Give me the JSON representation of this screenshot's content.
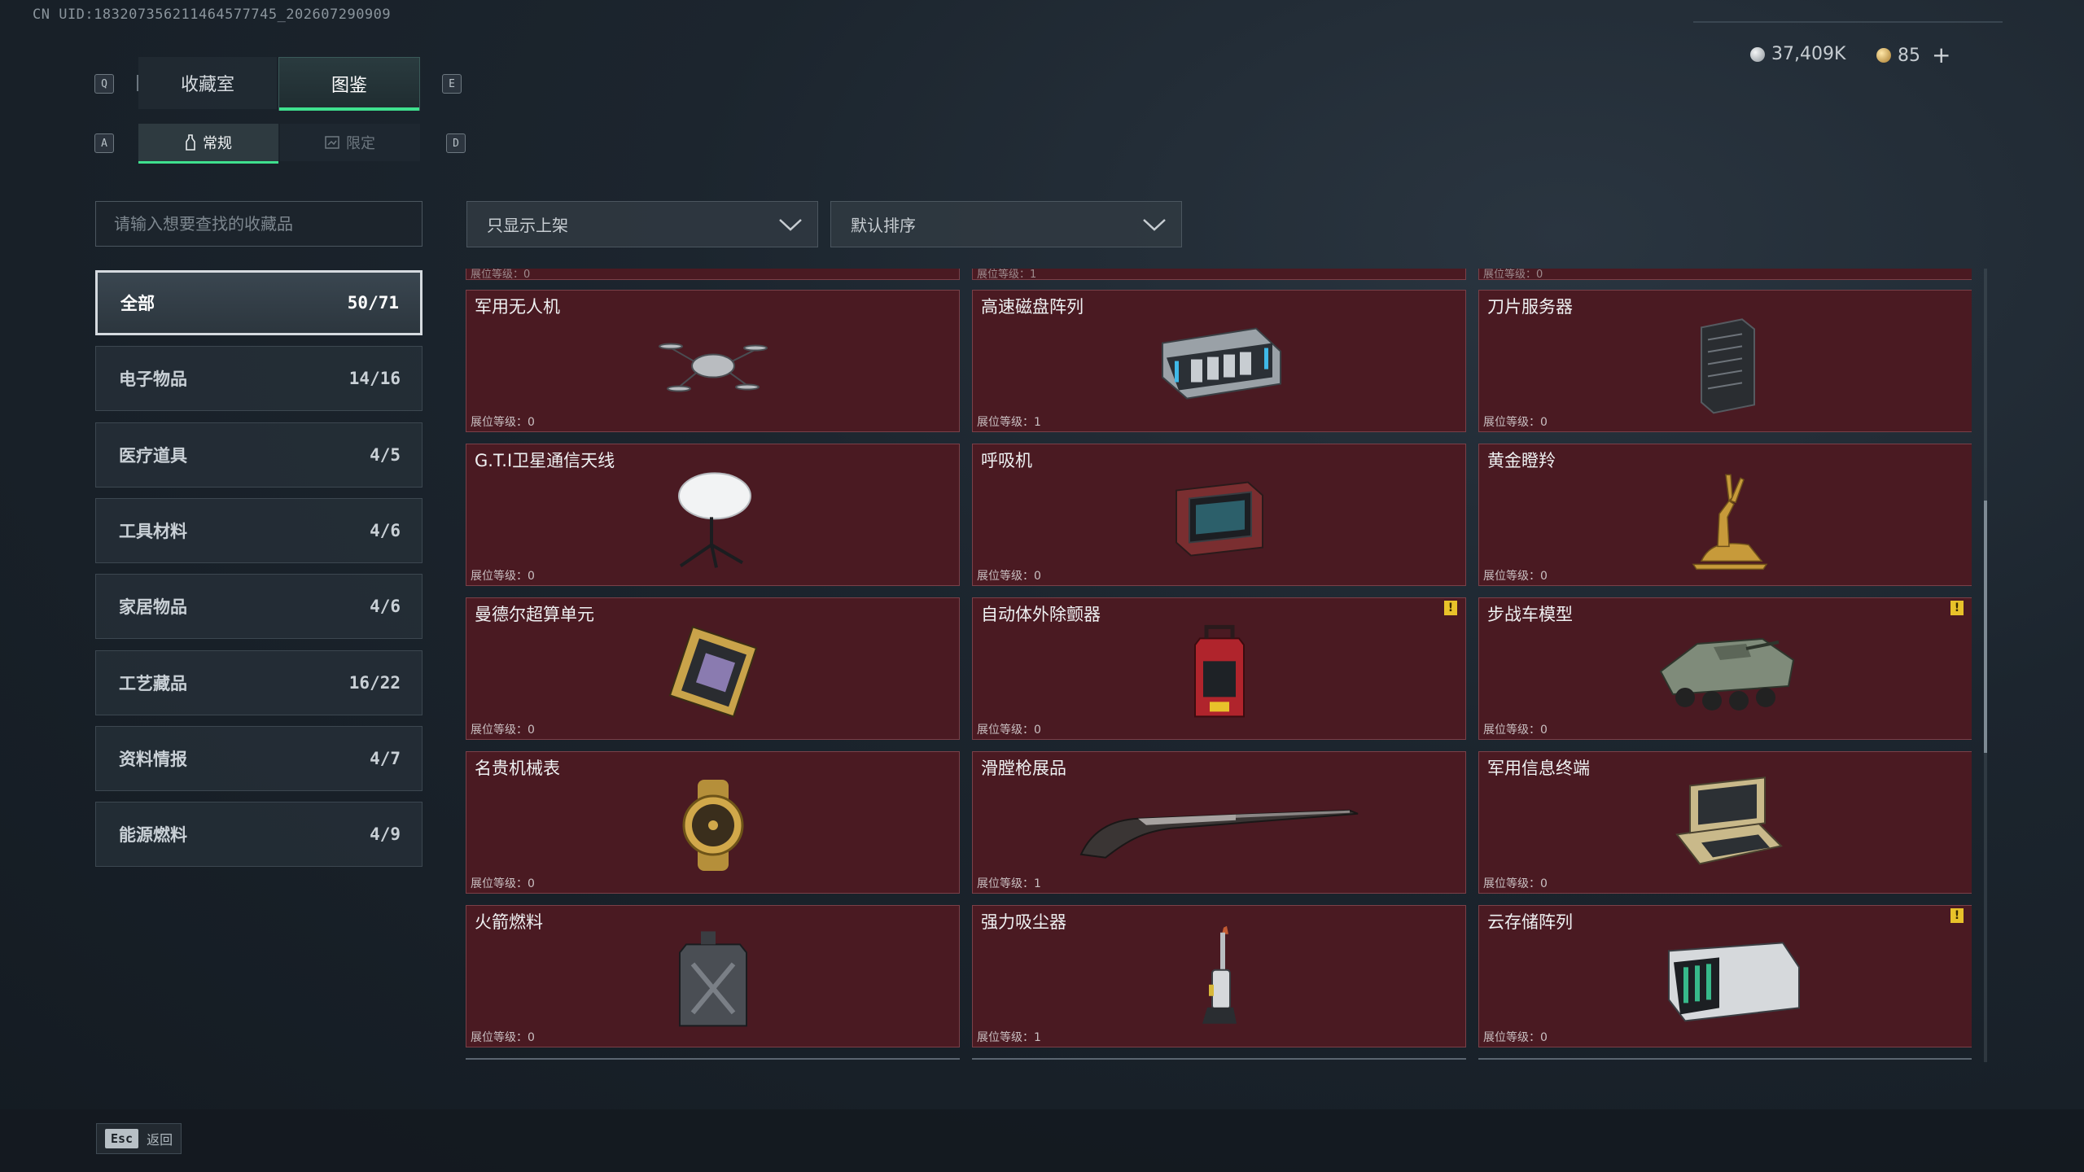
{
  "uid_text": "CN UID:183207356211464577745_202607290909",
  "currency": {
    "silver": "37,409K",
    "gold": "85",
    "add": "+"
  },
  "key_hints": {
    "q": "Q",
    "e": "E",
    "a": "A",
    "d": "D"
  },
  "tabs": [
    {
      "label": "收藏室",
      "active": false
    },
    {
      "label": "图鉴",
      "active": true
    }
  ],
  "subtabs": [
    {
      "label": "常规",
      "active": true
    },
    {
      "label": "限定",
      "active": false
    }
  ],
  "search": {
    "placeholder": "请输入想要查找的收藏品"
  },
  "filters": {
    "display": "只显示上架",
    "sort": "默认排序"
  },
  "categories": [
    {
      "label": "全部",
      "count": "50/71",
      "active": true
    },
    {
      "label": "电子物品",
      "count": "14/16"
    },
    {
      "label": "医疗道具",
      "count": "4/5"
    },
    {
      "label": "工具材料",
      "count": "4/6"
    },
    {
      "label": "家居物品",
      "count": "4/6"
    },
    {
      "label": "工艺藏品",
      "count": "16/22"
    },
    {
      "label": "资料情报",
      "count": "4/7"
    },
    {
      "label": "能源燃料",
      "count": "4/9"
    }
  ],
  "peek_row": [
    "展位等级：0",
    "展位等级：1",
    "展位等级：0"
  ],
  "items": [
    {
      "name": "军用无人机",
      "level": "展位等级：0",
      "icon": "drone-icon"
    },
    {
      "name": "高速磁盘阵列",
      "level": "展位等级：1",
      "icon": "disk-array-icon"
    },
    {
      "name": "刀片服务器",
      "level": "展位等级：0",
      "icon": "server-icon"
    },
    {
      "name": "G.T.I卫星通信天线",
      "level": "展位等级：0",
      "icon": "satellite-dish-icon"
    },
    {
      "name": "呼吸机",
      "level": "展位等级：0",
      "icon": "ventilator-icon"
    },
    {
      "name": "黄金瞪羚",
      "level": "展位等级：0",
      "icon": "gazelle-icon"
    },
    {
      "name": "曼德尔超算单元",
      "level": "展位等级：0",
      "icon": "compute-unit-icon"
    },
    {
      "name": "自动体外除颤器",
      "level": "展位等级：0",
      "icon": "defibrillator-icon",
      "warn": "!"
    },
    {
      "name": "步战车模型",
      "level": "展位等级：0",
      "icon": "apc-icon",
      "warn": "!"
    },
    {
      "name": "名贵机械表",
      "level": "展位等级：0",
      "icon": "watch-icon"
    },
    {
      "name": "滑膛枪展品",
      "level": "展位等级：1",
      "icon": "musket-icon"
    },
    {
      "name": "军用信息终端",
      "level": "展位等级：0",
      "icon": "terminal-icon"
    },
    {
      "name": "火箭燃料",
      "level": "展位等级：0",
      "icon": "fuel-can-icon"
    },
    {
      "name": "强力吸尘器",
      "level": "展位等级：1",
      "icon": "vacuum-icon"
    },
    {
      "name": "云存储阵列",
      "level": "展位等级：0",
      "icon": "cloud-storage-icon",
      "warn": "!"
    }
  ],
  "footer": {
    "esc_key": "Esc",
    "esc_label": "返回"
  },
  "colors": {
    "accent": "#3fe08e",
    "card_bg": "#4a1a22",
    "warn": "#e8c22a"
  }
}
